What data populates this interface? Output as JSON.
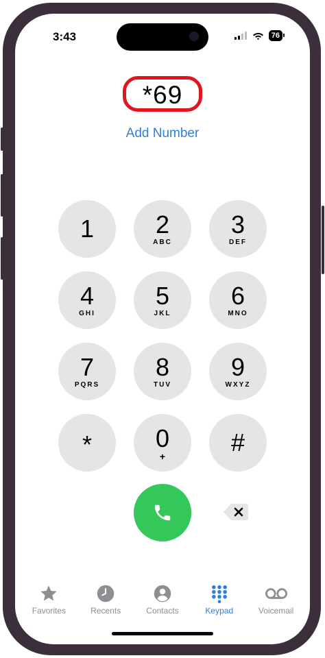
{
  "status_bar": {
    "time": "3:43",
    "battery": "76"
  },
  "dialer": {
    "number": "*69",
    "add_number_label": "Add Number"
  },
  "keypad": [
    {
      "digit": "1",
      "letters": ""
    },
    {
      "digit": "2",
      "letters": "ABC"
    },
    {
      "digit": "3",
      "letters": "DEF"
    },
    {
      "digit": "4",
      "letters": "GHI"
    },
    {
      "digit": "5",
      "letters": "JKL"
    },
    {
      "digit": "6",
      "letters": "MNO"
    },
    {
      "digit": "7",
      "letters": "PQRS"
    },
    {
      "digit": "8",
      "letters": "TUV"
    },
    {
      "digit": "9",
      "letters": "WXYZ"
    },
    {
      "digit": "*",
      "letters": ""
    },
    {
      "digit": "0",
      "letters": "+"
    },
    {
      "digit": "#",
      "letters": ""
    }
  ],
  "tabs": [
    {
      "label": "Favorites",
      "icon": "star-icon"
    },
    {
      "label": "Recents",
      "icon": "clock-icon"
    },
    {
      "label": "Contacts",
      "icon": "person-icon"
    },
    {
      "label": "Keypad",
      "icon": "keypad-icon"
    },
    {
      "label": "Voicemail",
      "icon": "voicemail-icon"
    }
  ],
  "colors": {
    "accent": "#2f7fd6",
    "call": "#34c759",
    "highlight": "#e0161e",
    "key_bg": "#e5e5e7"
  }
}
